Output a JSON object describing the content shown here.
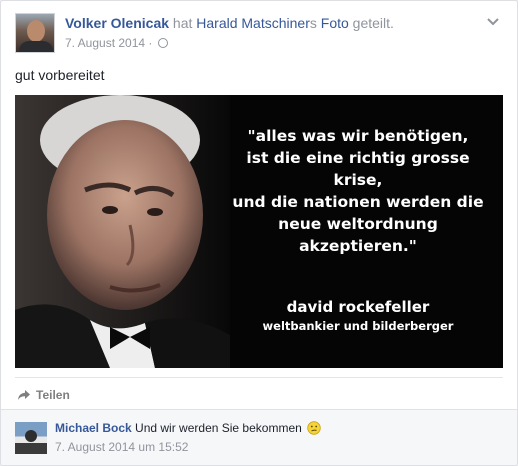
{
  "post": {
    "author": "Volker Olenicak",
    "action_prefix": "hat",
    "shared_owner": "Harald Matschiner",
    "possessive_suffix": "s",
    "shared_object": "Foto",
    "action_suffix": "geteilt.",
    "date": "7. August 2014",
    "separator": "·",
    "privacy_icon": "globe-icon",
    "text": "gut vorbereitet"
  },
  "image": {
    "quote_lines": [
      "\"alles was wir benötigen,",
      "ist die eine richtig grosse krise,",
      "und die nationen werden die",
      "neue weltordnung akzeptieren.\""
    ],
    "author_name": "david rockefeller",
    "author_title": "weltbankier und bilderberger"
  },
  "actions": {
    "share_label": "Teilen",
    "share_icon": "share-arrow-icon"
  },
  "comment": {
    "author": "Michael Bock",
    "text": "Und wir werden Sie bekommen",
    "emoji": "confused-smiley-icon",
    "timestamp": "7. August 2014 um 15:52"
  },
  "colors": {
    "link": "#365899",
    "muted": "#90949c",
    "image_background": "#050505"
  }
}
